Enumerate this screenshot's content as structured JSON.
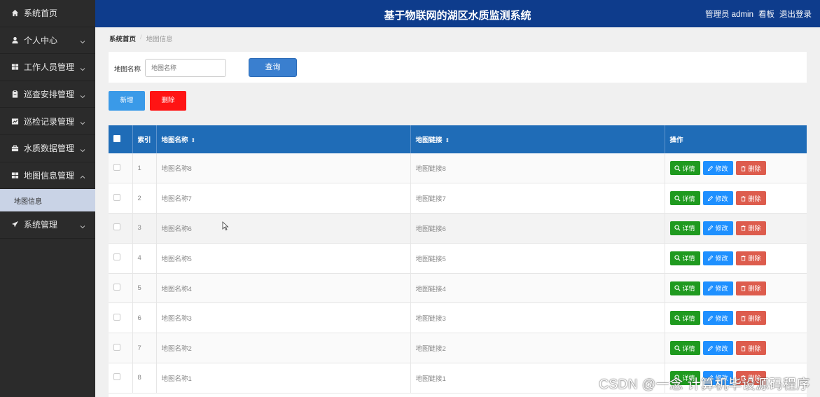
{
  "header": {
    "title": "基于物联网的湖区水质监测系统",
    "admin": "管理员 admin",
    "dashboard": "看板",
    "logout": "退出登录"
  },
  "sidebar": {
    "items": [
      {
        "label": "系统首页",
        "icon": "home-icon"
      },
      {
        "label": "个人中心",
        "icon": "user-icon"
      },
      {
        "label": "工作人员管理",
        "icon": "grid-icon"
      },
      {
        "label": "巡查安排管理",
        "icon": "clipboard-icon"
      },
      {
        "label": "巡检记录管理",
        "icon": "chart-icon"
      },
      {
        "label": "水质数据管理",
        "icon": "briefcase-icon"
      },
      {
        "label": "地图信息管理",
        "icon": "grid-icon"
      },
      {
        "label": "系统管理",
        "icon": "send-icon"
      }
    ],
    "sub_item": "地图信息"
  },
  "breadcrumb": {
    "home": "系统首页",
    "sep": "/",
    "current": "地图信息"
  },
  "search": {
    "label": "地图名称",
    "placeholder": "地图名称",
    "query_button": "查询"
  },
  "actions": {
    "add": "新增",
    "delete": "删除"
  },
  "table": {
    "columns": [
      "索引",
      "地图名称",
      "地图链接",
      "操作"
    ],
    "rows": [
      {
        "index": "1",
        "name": "地图名称8",
        "link": "地图链接8"
      },
      {
        "index": "2",
        "name": "地图名称7",
        "link": "地图链接7"
      },
      {
        "index": "3",
        "name": "地图名称6",
        "link": "地图链接6"
      },
      {
        "index": "4",
        "name": "地图名称5",
        "link": "地图链接5"
      },
      {
        "index": "5",
        "name": "地图名称4",
        "link": "地图链接4"
      },
      {
        "index": "6",
        "name": "地图名称3",
        "link": "地图链接3"
      },
      {
        "index": "7",
        "name": "地图名称2",
        "link": "地图链接2"
      },
      {
        "index": "8",
        "name": "地图名称1",
        "link": "地图链接1"
      }
    ],
    "op_labels": {
      "detail": "详情",
      "edit": "修改",
      "remove": "删除"
    }
  },
  "watermark": "CSDN @一念 计算机毕设源码程序",
  "colors": {
    "header_bg": "#0e3c8c",
    "sidebar_bg": "#2b2b2b",
    "table_head": "#1f6cb7",
    "detail": "#1f9a1f",
    "edit": "#1e90ff",
    "remove": "#dd5c4d",
    "add": "#3a9ae8",
    "delete": "#ff1414"
  }
}
